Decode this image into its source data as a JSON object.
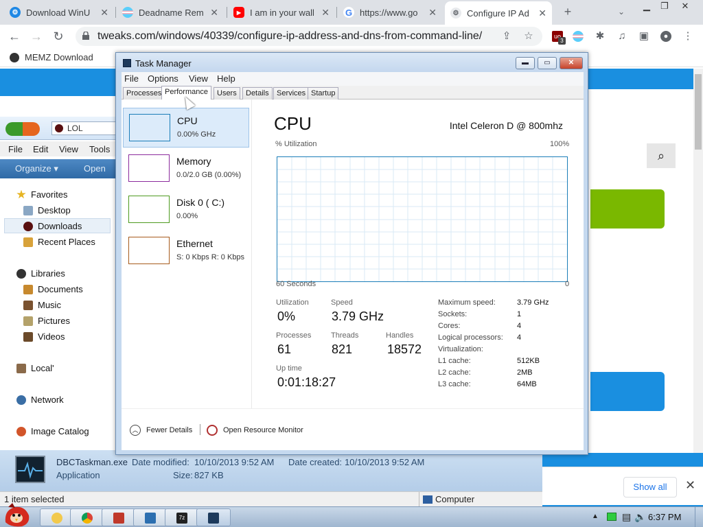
{
  "browser": {
    "tabs": [
      {
        "title": "Download WinU",
        "icon": "gear-icon",
        "color": "#1e88e5"
      },
      {
        "title": "Deadname Rem",
        "icon": "trans-flag-icon",
        "color": "#f5a9b8"
      },
      {
        "title": "I am in your wall",
        "icon": "youtube-icon",
        "color": "#ff0000"
      },
      {
        "title": "https://www.go",
        "icon": "google-icon",
        "color": "#4285f4"
      },
      {
        "title": "Configure IP Ad",
        "icon": "settings-icon",
        "color": "#9aa0a6"
      }
    ],
    "url": "tweaks.com/windows/40339/configure-ip-address-and-dns-from-command-line/",
    "bookmark": "MEMZ Download",
    "extension_badge": "3",
    "show_all": "Show all"
  },
  "explorer": {
    "breadcrumb": "LOL",
    "menu": [
      "File",
      "Edit",
      "View",
      "Tools"
    ],
    "organize": "Organize ▾",
    "open": "Open",
    "tree": {
      "favorites": "Favorites",
      "desktop": "Desktop",
      "downloads": "Downloads",
      "recent": "Recent Places",
      "libraries": "Libraries",
      "documents": "Documents",
      "music": "Music",
      "pictures": "Pictures",
      "videos": "Videos",
      "local": "Local'",
      "network": "Network",
      "image_catalog": "Image Catalog"
    },
    "details": {
      "filename": "DBCTaskman.exe",
      "date_modified_label": "Date modified:",
      "date_modified": "10/10/2013 9:52 AM",
      "date_created_label": "Date created:",
      "date_created": "10/10/2013 9:52 AM",
      "type": "Application",
      "size_label": "Size:",
      "size": "827 KB"
    },
    "status_left": "1 item selected",
    "status_right": "Computer"
  },
  "taskmgr": {
    "title": "Task Manager",
    "menu": [
      "File",
      "Options",
      "View",
      "Help"
    ],
    "tabs": [
      "Processes",
      "Performance",
      "Users",
      "Details",
      "Services",
      "Startup"
    ],
    "resources": [
      {
        "name": "CPU",
        "value": "0.00%   GHz",
        "color": "#1a7db8"
      },
      {
        "name": "Memory",
        "value": "0.0/2.0 GB (0.00%)",
        "color": "#8b2a9c"
      },
      {
        "name": "Disk 0 ( C:)",
        "value": "0.00%",
        "color": "#4d9a1e"
      },
      {
        "name": "Ethernet",
        "value": "S: 0 Kbps R: 0 Kbps",
        "color": "#a65a1b"
      }
    ],
    "cpu_title": "CPU",
    "cpu_model": "Intel Celeron D @ 800mhz",
    "graph_y_label": "% Utilization",
    "graph_y_max": "100%",
    "graph_x_label": "60 Seconds",
    "graph_x_min": "0",
    "stats": {
      "utilization_label": "Utilization",
      "utilization": "0%",
      "speed_label": "Speed",
      "speed": "3.79 GHz",
      "processes_label": "Processes",
      "processes": "61",
      "threads_label": "Threads",
      "threads": "821",
      "handles_label": "Handles",
      "handles": "18572",
      "uptime_label": "Up time",
      "uptime": "0:01:18:27"
    },
    "specs": [
      {
        "label": "Maximum speed:",
        "value": "3.79 GHz"
      },
      {
        "label": "Sockets:",
        "value": "1"
      },
      {
        "label": "Cores:",
        "value": "4"
      },
      {
        "label": "Logical processors:",
        "value": "4"
      },
      {
        "label": "Virtualization:",
        "value": ""
      },
      {
        "label": "L1 cache:",
        "value": "512KB"
      },
      {
        "label": "L2 cache:",
        "value": "2MB"
      },
      {
        "label": "L3 cache:",
        "value": "64MB"
      }
    ],
    "fewer_details": "Fewer Details",
    "resource_monitor": "Open Resource Monitor"
  },
  "taskbar": {
    "clock": "6:37 PM",
    "apps": [
      {
        "icon": "folder-icon",
        "color": "#f2c94c"
      },
      {
        "icon": "chrome-icon",
        "color": "#db4437"
      },
      {
        "icon": "paint-icon",
        "color": "#c0392b"
      },
      {
        "icon": "monitor-icon",
        "color": "#2c6fb0"
      },
      {
        "icon": "7zip-icon",
        "color": "#222222"
      },
      {
        "icon": "taskmgr-icon",
        "color": "#1d3a5c"
      }
    ]
  }
}
